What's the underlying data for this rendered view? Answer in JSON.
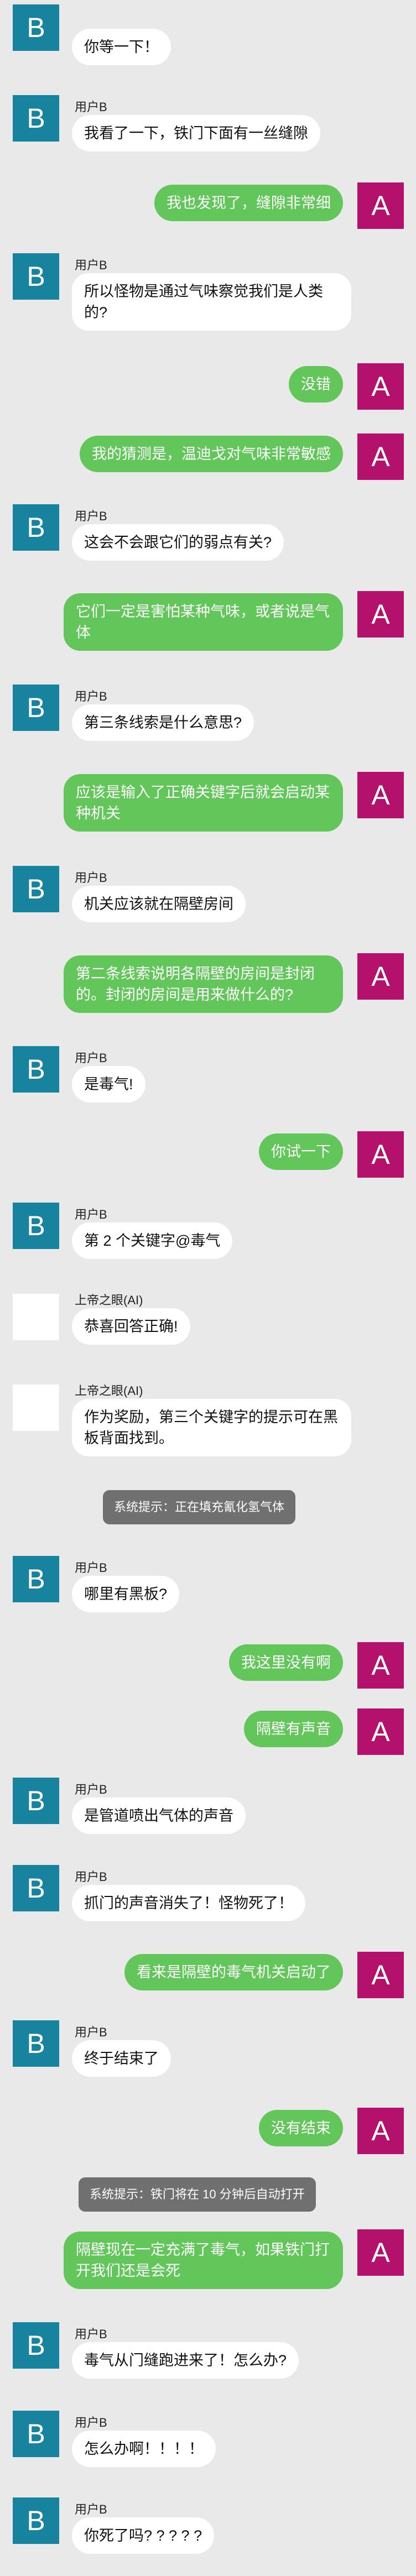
{
  "avatars": {
    "user_b": "B",
    "user_a": "A"
  },
  "messages": [
    {
      "sender": "用户B",
      "text": "你等一下！"
    },
    {
      "sender": "用户B",
      "text": "我看了一下，铁门下面有一丝缝隙"
    },
    {
      "text": "我也发现了，缝隙非常细"
    },
    {
      "sender": "用户B",
      "text": "所以怪物是通过气味察觉我们是人类的?"
    },
    {
      "text": "没错"
    },
    {
      "text": "我的猜测是，温迪戈对气味非常敏感"
    },
    {
      "sender": "用户B",
      "text": "这会不会跟它们的弱点有关?"
    },
    {
      "text": "它们一定是害怕某种气味，或者说是气体"
    },
    {
      "sender": "用户B",
      "text": "第三条线索是什么意思?"
    },
    {
      "text": "应该是输入了正确关键字后就会启动某种机关"
    },
    {
      "sender": "用户B",
      "text": "机关应该就在隔壁房间"
    },
    {
      "text": "第二条线索说明各隔壁的房间是封闭的。封闭的房间是用来做什么的?"
    },
    {
      "sender": "用户B",
      "text": "是毒气!"
    },
    {
      "text": "你试一下"
    },
    {
      "sender": "用户B",
      "text": "第 2 个关键字@毒气"
    },
    {
      "sender": "上帝之眼(AI)",
      "text": "恭喜回答正确!"
    },
    {
      "sender": "上帝之眼(AI)",
      "text": "作为奖励，第三个关键字的提示可在黑板背面找到。"
    },
    {
      "text": "系统提示：正在填充氰化氢气体"
    },
    {
      "sender": "用户B",
      "text": "哪里有黑板?"
    },
    {
      "text": "我这里没有啊"
    },
    {
      "text": "隔壁有声音"
    },
    {
      "sender": "用户B",
      "text": "是管道喷出气体的声音"
    },
    {
      "sender": "用户B",
      "text": "抓门的声音消失了！怪物死了！"
    },
    {
      "text": "看来是隔壁的毒气机关启动了"
    },
    {
      "sender": "用户B",
      "text": "终于结束了"
    },
    {
      "text": "没有结束"
    },
    {
      "text": "系统提示：铁门将在 10 分钟后自动打开"
    },
    {
      "text": "隔壁现在一定充满了毒气，如果铁门打开我们还是会死"
    },
    {
      "sender": "用户B",
      "text": "毒气从门缝跑进来了！怎么办?"
    },
    {
      "sender": "用户B",
      "text": "怎么办啊！！！！"
    },
    {
      "sender": "用户B",
      "text": "你死了吗? ? ? ? ?"
    }
  ]
}
